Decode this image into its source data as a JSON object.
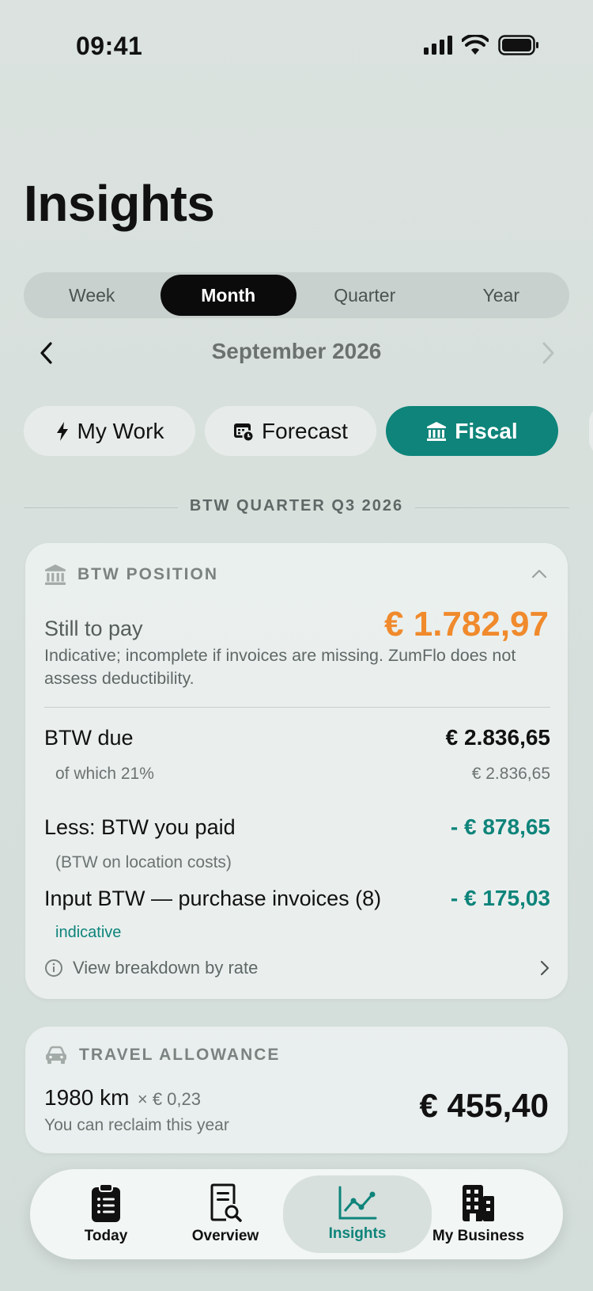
{
  "status_bar": {
    "time": "09:41"
  },
  "page": {
    "title": "Insights"
  },
  "period_tabs": [
    {
      "label": "Week",
      "active": false
    },
    {
      "label": "Month",
      "active": true
    },
    {
      "label": "Quarter",
      "active": false
    },
    {
      "label": "Year",
      "active": false
    }
  ],
  "period_nav": {
    "label": "September 2026"
  },
  "view_pills": [
    {
      "label": "My Work",
      "icon": "bolt-icon"
    },
    {
      "label": "Forecast",
      "icon": "calendar-clock-icon"
    },
    {
      "label": "Fiscal",
      "icon": "bank-icon",
      "active": true
    }
  ],
  "section": {
    "label": "BTW QUARTER Q3 2026"
  },
  "btw_card": {
    "header": "BTW POSITION",
    "still_to_pay_label": "Still to pay",
    "still_to_pay_value": "€ 1.782,97",
    "disclaimer": "Indicative; incomplete if invoices are missing. ZumFlo does not assess deductibility.",
    "due_label": "BTW due",
    "due_value": "€ 2.836,65",
    "due_sub_label": "of which 21%",
    "due_sub_value": "€ 2.836,65",
    "paid_label": "Less: BTW you paid",
    "paid_value": "- € 878,65",
    "paid_sub_label": "(BTW on location costs)",
    "input_label": "Input BTW — purchase invoices (8)",
    "input_value": "- € 175,03",
    "input_tag": "indicative",
    "breakdown_link": "View breakdown by rate",
    "accent_color": "#f08a2c",
    "teal_color": "#0e847a"
  },
  "travel_card": {
    "header": "TRAVEL ALLOWANCE",
    "distance": "1980 km",
    "rate": "× € 0,23",
    "subtitle": "You can reclaim this year",
    "amount": "€ 455,40"
  },
  "tab_bar": [
    {
      "label": "Today",
      "icon": "clipboard-list-icon"
    },
    {
      "label": "Overview",
      "icon": "document-search-icon"
    },
    {
      "label": "Insights",
      "icon": "line-chart-icon",
      "active": true
    },
    {
      "label": "My Business",
      "icon": "building-icon"
    }
  ]
}
